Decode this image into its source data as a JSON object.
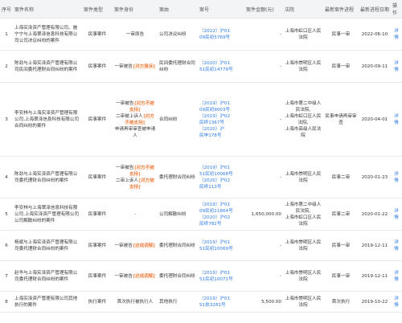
{
  "headers": [
    "序号",
    "案件名称",
    "案件类型",
    "案件身份",
    "案由",
    "案号",
    "案件金额(元)",
    "法院",
    "最新案件进程",
    "最新进程日期",
    "操作"
  ],
  "rows": [
    {
      "no": "1",
      "name": "上海实泽资产管理有限公司、施宁宁与上海翠泽信息科技有限公司公司决议纠纷的案件",
      "type": "民事案件",
      "roles": [
        {
          "text": "一审原告",
          "tag": ""
        }
      ],
      "cause": "公司决议纠纷",
      "case_no": [
        "（2022）沪01",
        "09民初5769号"
      ],
      "amount": "-",
      "court": [
        "上海市虹口区人民法院"
      ],
      "stage": "民事一审",
      "date": "2022-06-10",
      "op": "详情"
    },
    {
      "no": "2",
      "name": "陈劲与上海实泽资产管理有限公司民间委托理财合同纠纷的案件",
      "type": "民事案件",
      "roles": [
        {
          "text": "一审被告",
          "tag": "[对方撤诉]"
        }
      ],
      "cause": "民间委托理财合同纠纷",
      "case_no": [
        "（2020）沪01",
        "51民初14779号"
      ],
      "amount": "-",
      "court": [
        "上海市崇明区人民法院"
      ],
      "stage": "民事一审",
      "date": "2020-09-11",
      "op": "详情"
    },
    {
      "no": "3",
      "name": "李安林与上海实泽资产管理有限公司,上海翠泽信息科技有限公司合同纠纷的案件",
      "type": "民事案件",
      "roles": [
        {
          "text": "一审被告",
          "tag": "[对方不被支持]"
        },
        {
          "text": "二审被上诉人",
          "tag": "[对方不被支持]"
        },
        {
          "text": "申请再审审查被申请人",
          "tag": ""
        }
      ],
      "cause": "合同纠纷",
      "case_no": [
        "（2019）沪01",
        "09民初9003号",
        "（2019）沪02",
        "民终1367号",
        "（2020）沪",
        "民申178号"
      ],
      "amount": "-",
      "court": [
        "上海市第二中级人民法院,",
        "上海市虹口区人民法院,",
        "上海市高级人民法院"
      ],
      "stage": "民事申请再审审查",
      "date": "2020-04-01",
      "op": "详情"
    },
    {
      "no": "4",
      "name": "陈劲与上海实泽资产管理有限公司委托理财合同纠纷的案件",
      "type": "民事案件",
      "roles": [
        {
          "text": "一审被告",
          "tag": "[对方不被支持]"
        },
        {
          "text": "二审上诉人",
          "tag": "[对方被支持]"
        }
      ],
      "cause": "委托理财合同纠纷",
      "case_no": [
        "（2019）沪01",
        "51民初10068号",
        "（2020）沪02",
        "民终113号"
      ],
      "amount": "-",
      "court": [
        "上海市崇明区人民法院"
      ],
      "stage": "民事二审",
      "date": "2020-01-23",
      "op": "详情"
    },
    {
      "no": "5",
      "name": "李安林与上海翠泽信息科技有限公司,上海实泽资产管理有限公司公司解散纠纷的案件",
      "type": "民事案件",
      "roles": [
        {
          "text": "-",
          "tag": ""
        }
      ],
      "cause": "公司解散纠纷",
      "case_no": [
        "（2019）沪01",
        "09民初21864号",
        "（2020）沪02",
        "民终782号"
      ],
      "amount": "1,650,000.00",
      "court": [
        "上海市第二中级人民法院,",
        "上海市虹口区人民法院"
      ],
      "stage": "民事二审",
      "date": "2020-01-22",
      "op": "详情"
    },
    {
      "no": "6",
      "name": "杨斌与上海实泽资产管理有限公司委托理财合同纠纷的案件",
      "type": "民事案件",
      "roles": [
        {
          "text": "一审被告",
          "tag": "[达成调解]"
        }
      ],
      "cause": "委托理财合同纠纷",
      "case_no": [
        "（2019）沪01",
        "51民初10069号"
      ],
      "amount": "-",
      "court": [
        "上海市崇明区人民法院"
      ],
      "stage": "民事一审",
      "date": "2019-12-11",
      "op": "详情"
    },
    {
      "no": "7",
      "name": "赵华与上海实泽资产管理有限公司委托理财合同纠纷的案件",
      "type": "民事案件",
      "roles": [
        {
          "text": "一审被告",
          "tag": "[达成调解]"
        }
      ],
      "cause": "委托理财合同纠纷",
      "case_no": [
        "（2019）沪01",
        "51民初10071号"
      ],
      "amount": "-",
      "court": [
        "上海市崇明区人民法院"
      ],
      "stage": "民事一审",
      "date": "2019-12-11",
      "op": "详情"
    },
    {
      "no": "8",
      "name": "上海实泽资产管理有限公司其他执行的案件",
      "type": "执行案件",
      "roles": [
        {
          "text": "首次执行被执行人",
          "tag": ""
        }
      ],
      "cause": "其他执行",
      "case_no": [
        "（2019）沪01",
        "51执3281号"
      ],
      "amount": "5,500.00",
      "court": [
        "上海市崇明区人民法院"
      ],
      "stage": "首次执行",
      "date": "2019-10-22",
      "op": "详情"
    }
  ]
}
